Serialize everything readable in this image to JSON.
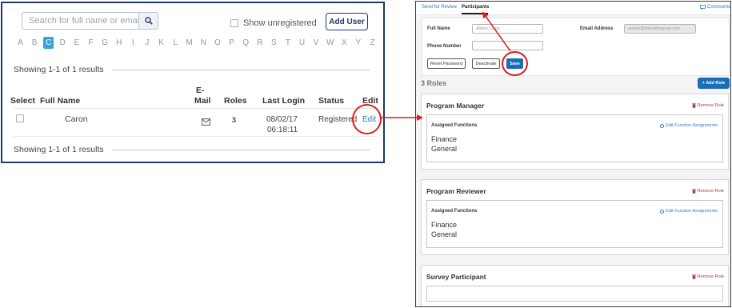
{
  "left_panel": {
    "search": {
      "placeholder": "Search for full name or email",
      "icon": "search-icon"
    },
    "show_unregistered_label": "Show unregistered",
    "add_user_label": "Add User",
    "alphabet": [
      "A",
      "B",
      "C",
      "D",
      "E",
      "F",
      "G",
      "H",
      "I",
      "J",
      "K",
      "L",
      "M",
      "N",
      "O",
      "P",
      "Q",
      "R",
      "S",
      "T",
      "U",
      "V",
      "W",
      "X",
      "Y",
      "Z"
    ],
    "active_letter": "C",
    "showing_top": "Showing 1-1 of 1 results",
    "showing_bottom": "Showing 1-1 of 1 results",
    "columns": {
      "select": "Select",
      "full_name": "Full Name",
      "email_line1": "E-",
      "email_line2": "Mail",
      "roles": "Roles",
      "last_login": "Last Login",
      "status": "Status",
      "edit": "Edit"
    },
    "rows": [
      {
        "full_name": "Caron",
        "email_icon": "envelope-icon",
        "roles": "3",
        "last_login_date": "08/02/17",
        "last_login_time": "06:18:11",
        "status": "Registered",
        "edit_label": "Edit"
      }
    ]
  },
  "right_panel": {
    "tabs": [
      {
        "label": "Send for Review",
        "active": false
      },
      {
        "label": "Participants",
        "active": true
      }
    ],
    "comments_label": "Comments",
    "form": {
      "full_name_label": "Full Name",
      "full_name_value": "Allison Caron",
      "email_label": "Email Address",
      "email_value": "acaron@theholdergroup.com",
      "phone_label": "Phone Number",
      "phone_value": "",
      "reset_password_label": "Reset Password",
      "deactivate_label": "Deactivate",
      "save_label": "Save"
    },
    "roles_title": "3 Roles",
    "add_role_label": "+ Add Role",
    "roles": [
      {
        "title": "Program Manager",
        "remove_label": "Remove Role",
        "assigned_label": "Assigned Functions",
        "edit_label": "Edit Function Assignments",
        "functions": [
          "Finance",
          "General"
        ]
      },
      {
        "title": "Program Reviewer",
        "remove_label": "Remove Role",
        "assigned_label": "Assigned Functions",
        "edit_label": "Edit Function Assignments",
        "functions": [
          "Finance",
          "General"
        ]
      },
      {
        "title": "Survey Participant",
        "remove_label": "Remove Role"
      }
    ]
  },
  "colors": {
    "panel_border": "#1f3864",
    "active_letter_bg": "#36a3d9",
    "highlight_red": "#e01b1b",
    "primary_button": "#1b6db5",
    "link": "#2c7dc1",
    "remove_link": "#b03c3c"
  }
}
